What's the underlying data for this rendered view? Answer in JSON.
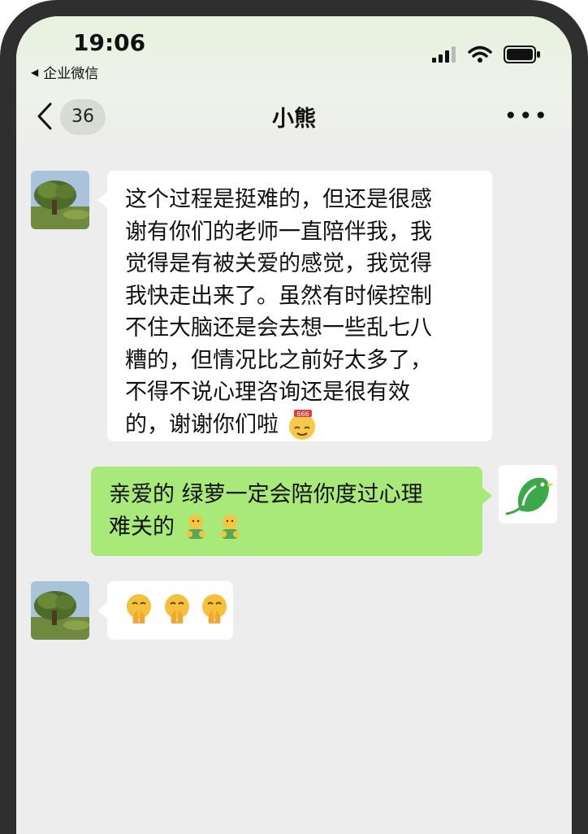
{
  "status_bar": {
    "time": "19:06",
    "back_app_label": "企业微信",
    "icons": [
      "cellular-signal-icon",
      "wifi-icon",
      "battery-icon"
    ]
  },
  "header": {
    "back_icon": "chevron-left-icon",
    "unread_count": "36",
    "title": "小熊",
    "more_icon": "more-dots-icon",
    "more_label": "•••"
  },
  "colors": {
    "screen_bg": "#ededed",
    "incoming_bubble": "#ffffff",
    "outgoing_bubble": "#a9e97a",
    "frame": "#2f2f2f"
  },
  "messages": [
    {
      "side": "left",
      "sender": "小熊",
      "avatar": "tree-landscape-avatar",
      "lines": [
        "这个过程是挺难的，但还是很感",
        "谢有你们的老师一直陪伴我，我",
        "觉得是有被关爱的感觉，我觉得",
        "我快走出来了。虽然有时候控制",
        "不住大脑还是会去想一些乱七八",
        "糟的，但情况比之前好太多了，",
        "不得不说心理咨询还是很有效",
        "的，谢谢你们啦"
      ],
      "trailing_emoji": "666-emoji"
    },
    {
      "side": "right",
      "sender": "绿萝",
      "avatar": "green-bird-logo-avatar",
      "lines": [
        "亲爱的 绿萝一定会陪你度过心理",
        "难关的"
      ],
      "trailing_emoji": [
        "hug-emoji",
        "hug-emoji"
      ]
    },
    {
      "side": "left",
      "sender": "小熊",
      "avatar": "tree-landscape-avatar",
      "lines": [],
      "trailing_emoji": [
        "pray-emoji",
        "pray-emoji",
        "pray-emoji"
      ]
    }
  ]
}
